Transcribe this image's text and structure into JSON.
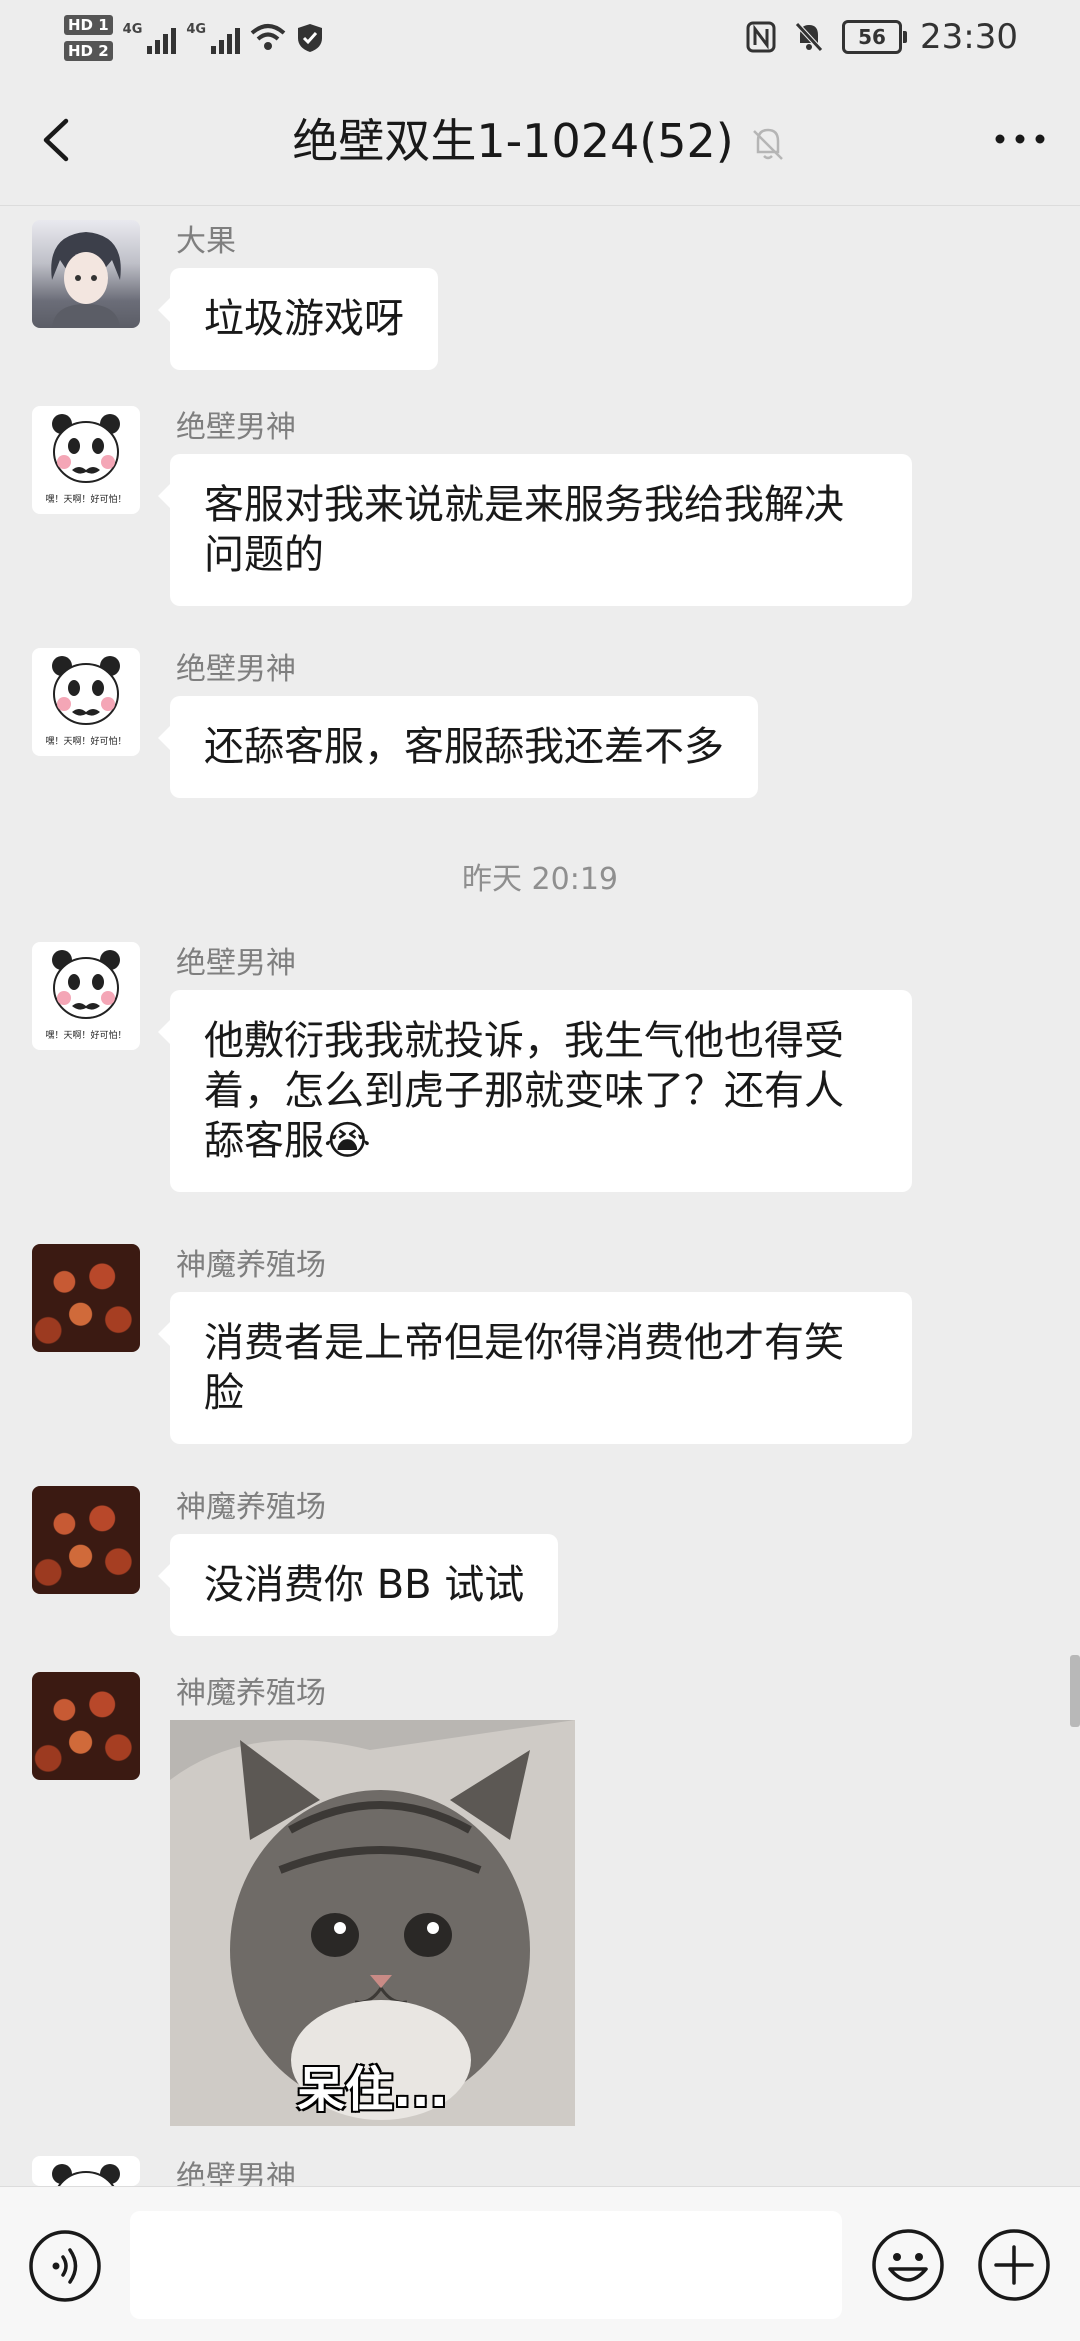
{
  "status_bar": {
    "hd1": "HD 1",
    "hd2": "HD 2",
    "network1": "4G",
    "network2": "4G",
    "battery": "56",
    "time": "23:30"
  },
  "header": {
    "title": "绝壁双生1-1024(52)"
  },
  "messages": [
    {
      "sender": "大果",
      "text": "垃圾游戏呀",
      "avatar": "anime-boy"
    },
    {
      "sender": "绝壁男神",
      "text": "客服对我来说就是来服务我给我解决问题的",
      "avatar": "panda"
    },
    {
      "sender": "绝壁男神",
      "text": "还舔客服，客服舔我还差不多",
      "avatar": "panda"
    },
    {
      "sender": "绝壁男神",
      "text": "他敷衍我我就投诉，我生气他也得受着，怎么到虎子那就变味了？还有人舔客服😭",
      "avatar": "panda"
    },
    {
      "sender": "神魔养殖场",
      "text": "消费者是上帝但是你得消费他才有笑脸",
      "avatar": "food"
    },
    {
      "sender": "神魔养殖场",
      "text": "没消费你 BB 试试",
      "avatar": "food"
    },
    {
      "sender": "神魔养殖场",
      "sticker_caption": "呆住...",
      "avatar": "food"
    },
    {
      "sender": "绝壁男神",
      "avatar": "panda"
    }
  ],
  "timestamp": "昨天 20:19",
  "avatar_panda_caption": "嘿！天啊！好可怕！",
  "icons": {
    "back": "chevron-left-icon",
    "mute": "bell-off-icon",
    "more": "more-dots-icon",
    "voice": "voice-icon",
    "emoji": "emoji-icon",
    "plus": "plus-icon"
  }
}
